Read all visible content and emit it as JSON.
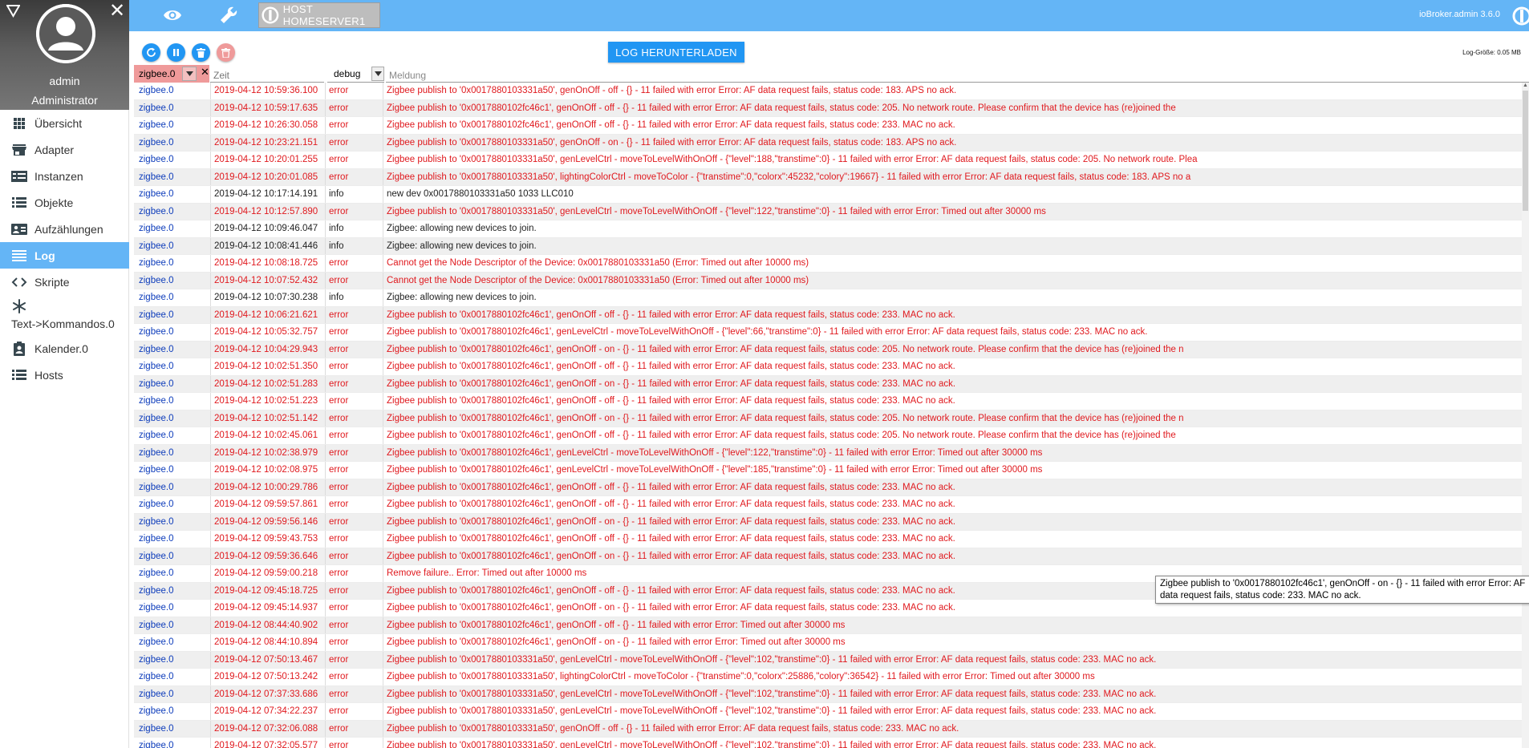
{
  "profile": {
    "name": "admin",
    "role": "Administrator"
  },
  "nav": [
    {
      "label": "Übersicht",
      "icon": "grid-icon",
      "active": false
    },
    {
      "label": "Adapter",
      "icon": "store-icon",
      "active": false
    },
    {
      "label": "Instanzen",
      "icon": "instances-icon",
      "active": false
    },
    {
      "label": "Objekte",
      "icon": "list-icon",
      "active": false
    },
    {
      "label": "Aufzählungen",
      "icon": "enum-icon",
      "active": false
    },
    {
      "label": "Log",
      "icon": "log-icon",
      "active": true
    },
    {
      "label": "Skripte",
      "icon": "code-icon",
      "active": false
    },
    {
      "label": "Text->Kommandos.0",
      "icon": "snowflake-icon",
      "active": false
    },
    {
      "label": "Kalender.0",
      "icon": "contact-icon",
      "active": false
    },
    {
      "label": "Hosts",
      "icon": "hosts-icon",
      "active": false
    }
  ],
  "topbar": {
    "host_label": "HOST HOMESERVER1",
    "version": "ioBroker.admin 3.6.0"
  },
  "toolbar": {
    "download_label": "LOG HERUNTERLADEN",
    "log_size": "Log-Größe: 0.05 MB"
  },
  "filters": {
    "instance": "zigbee.0",
    "time_placeholder": "Zeit",
    "severity": "debug",
    "message_placeholder": "Meldung"
  },
  "colors": {
    "accent": "#64b5f6",
    "button": "#2196f3",
    "error": "#e0191e",
    "instance": "#0d3cbb",
    "instance_filter": "#ef9a9a"
  },
  "tooltip": "Zigbee publish to '0x0017880102fc46c1', genOnOff - on - {} - 11 failed with error Error: AF data request fails, status code: 233. MAC no ack.",
  "log": [
    {
      "source": "zigbee.0",
      "time": "2019-04-12 10:59:36.100",
      "severity": "error",
      "message": "Zigbee publish to '0x0017880103331a50', genOnOff - off - {} - 11 failed with error Error: AF data request fails, status code: 183. APS no ack."
    },
    {
      "source": "zigbee.0",
      "time": "2019-04-12 10:59:17.635",
      "severity": "error",
      "message": "Zigbee publish to '0x0017880102fc46c1', genOnOff - off - {} - 11 failed with error Error: AF data request fails, status code: 205. No network route. Please confirm that the device has (re)joined the"
    },
    {
      "source": "zigbee.0",
      "time": "2019-04-12 10:26:30.058",
      "severity": "error",
      "message": "Zigbee publish to '0x0017880102fc46c1', genOnOff - off - {} - 11 failed with error Error: AF data request fails, status code: 233. MAC no ack."
    },
    {
      "source": "zigbee.0",
      "time": "2019-04-12 10:23:21.151",
      "severity": "error",
      "message": "Zigbee publish to '0x0017880103331a50', genOnOff - on - {} - 11 failed with error Error: AF data request fails, status code: 183. APS no ack."
    },
    {
      "source": "zigbee.0",
      "time": "2019-04-12 10:20:01.255",
      "severity": "error",
      "message": "Zigbee publish to '0x0017880103331a50', genLevelCtrl - moveToLevelWithOnOff - {\"level\":188,\"transtime\":0} - 11 failed with error Error: AF data request fails, status code: 205. No network route. Plea"
    },
    {
      "source": "zigbee.0",
      "time": "2019-04-12 10:20:01.085",
      "severity": "error",
      "message": "Zigbee publish to '0x0017880103331a50', lightingColorCtrl - moveToColor - {\"transtime\":0,\"colorx\":45232,\"colory\":19667} - 11 failed with error Error: AF data request fails, status code: 183. APS no a"
    },
    {
      "source": "zigbee.0",
      "time": "2019-04-12 10:17:14.191",
      "severity": "info",
      "message": "new dev 0x0017880103331a50 1033 LLC010"
    },
    {
      "source": "zigbee.0",
      "time": "2019-04-12 10:12:57.890",
      "severity": "error",
      "message": "Zigbee publish to '0x0017880103331a50', genLevelCtrl - moveToLevelWithOnOff - {\"level\":122,\"transtime\":0} - 11 failed with error Error: Timed out after 30000 ms"
    },
    {
      "source": "zigbee.0",
      "time": "2019-04-12 10:09:46.047",
      "severity": "info",
      "message": "Zigbee: allowing new devices to join."
    },
    {
      "source": "zigbee.0",
      "time": "2019-04-12 10:08:41.446",
      "severity": "info",
      "message": "Zigbee: allowing new devices to join."
    },
    {
      "source": "zigbee.0",
      "time": "2019-04-12 10:08:18.725",
      "severity": "error",
      "message": "Cannot get the Node Descriptor of the Device: 0x0017880103331a50 (Error: Timed out after 10000 ms)"
    },
    {
      "source": "zigbee.0",
      "time": "2019-04-12 10:07:52.432",
      "severity": "error",
      "message": "Cannot get the Node Descriptor of the Device: 0x0017880103331a50 (Error: Timed out after 10000 ms)"
    },
    {
      "source": "zigbee.0",
      "time": "2019-04-12 10:07:30.238",
      "severity": "info",
      "message": "Zigbee: allowing new devices to join."
    },
    {
      "source": "zigbee.0",
      "time": "2019-04-12 10:06:21.621",
      "severity": "error",
      "message": "Zigbee publish to '0x0017880102fc46c1', genOnOff - off - {} - 11 failed with error Error: AF data request fails, status code: 233. MAC no ack."
    },
    {
      "source": "zigbee.0",
      "time": "2019-04-12 10:05:32.757",
      "severity": "error",
      "message": "Zigbee publish to '0x0017880102fc46c1', genLevelCtrl - moveToLevelWithOnOff - {\"level\":66,\"transtime\":0} - 11 failed with error Error: AF data request fails, status code: 233. MAC no ack."
    },
    {
      "source": "zigbee.0",
      "time": "2019-04-12 10:04:29.943",
      "severity": "error",
      "message": "Zigbee publish to '0x0017880102fc46c1', genOnOff - on - {} - 11 failed with error Error: AF data request fails, status code: 205. No network route. Please confirm that the device has (re)joined the n"
    },
    {
      "source": "zigbee.0",
      "time": "2019-04-12 10:02:51.350",
      "severity": "error",
      "message": "Zigbee publish to '0x0017880102fc46c1', genOnOff - off - {} - 11 failed with error Error: AF data request fails, status code: 233. MAC no ack."
    },
    {
      "source": "zigbee.0",
      "time": "2019-04-12 10:02:51.283",
      "severity": "error",
      "message": "Zigbee publish to '0x0017880102fc46c1', genOnOff - on - {} - 11 failed with error Error: AF data request fails, status code: 233. MAC no ack."
    },
    {
      "source": "zigbee.0",
      "time": "2019-04-12 10:02:51.223",
      "severity": "error",
      "message": "Zigbee publish to '0x0017880102fc46c1', genOnOff - off - {} - 11 failed with error Error: AF data request fails, status code: 233. MAC no ack."
    },
    {
      "source": "zigbee.0",
      "time": "2019-04-12 10:02:51.142",
      "severity": "error",
      "message": "Zigbee publish to '0x0017880102fc46c1', genOnOff - on - {} - 11 failed with error Error: AF data request fails, status code: 205. No network route. Please confirm that the device has (re)joined the n"
    },
    {
      "source": "zigbee.0",
      "time": "2019-04-12 10:02:45.061",
      "severity": "error",
      "message": "Zigbee publish to '0x0017880102fc46c1', genOnOff - off - {} - 11 failed with error Error: AF data request fails, status code: 205. No network route. Please confirm that the device has (re)joined the"
    },
    {
      "source": "zigbee.0",
      "time": "2019-04-12 10:02:38.979",
      "severity": "error",
      "message": "Zigbee publish to '0x0017880102fc46c1', genLevelCtrl - moveToLevelWithOnOff - {\"level\":122,\"transtime\":0} - 11 failed with error Error: Timed out after 30000 ms"
    },
    {
      "source": "zigbee.0",
      "time": "2019-04-12 10:02:08.975",
      "severity": "error",
      "message": "Zigbee publish to '0x0017880102fc46c1', genLevelCtrl - moveToLevelWithOnOff - {\"level\":185,\"transtime\":0} - 11 failed with error Error: Timed out after 30000 ms"
    },
    {
      "source": "zigbee.0",
      "time": "2019-04-12 10:00:29.786",
      "severity": "error",
      "message": "Zigbee publish to '0x0017880102fc46c1', genOnOff - off - {} - 11 failed with error Error: AF data request fails, status code: 233. MAC no ack."
    },
    {
      "source": "zigbee.0",
      "time": "2019-04-12 09:59:57.861",
      "severity": "error",
      "message": "Zigbee publish to '0x0017880102fc46c1', genOnOff - off - {} - 11 failed with error Error: AF data request fails, status code: 233. MAC no ack."
    },
    {
      "source": "zigbee.0",
      "time": "2019-04-12 09:59:56.146",
      "severity": "error",
      "message": "Zigbee publish to '0x0017880102fc46c1', genOnOff - on - {} - 11 failed with error Error: AF data request fails, status code: 233. MAC no ack."
    },
    {
      "source": "zigbee.0",
      "time": "2019-04-12 09:59:43.753",
      "severity": "error",
      "message": "Zigbee publish to '0x0017880102fc46c1', genOnOff - off - {} - 11 failed with error Error: AF data request fails, status code: 233. MAC no ack."
    },
    {
      "source": "zigbee.0",
      "time": "2019-04-12 09:59:36.646",
      "severity": "error",
      "message": "Zigbee publish to '0x0017880102fc46c1', genOnOff - on - {} - 11 failed with error Error: AF data request fails, status code: 233. MAC no ack."
    },
    {
      "source": "zigbee.0",
      "time": "2019-04-12 09:59:00.218",
      "severity": "error",
      "message": "Remove failure.. Error: Timed out after 10000 ms"
    },
    {
      "source": "zigbee.0",
      "time": "2019-04-12 09:45:18.725",
      "severity": "error",
      "message": "Zigbee publish to '0x0017880102fc46c1', genOnOff - off - {} - 11 failed with error Error: AF data request fails, status code: 233. MAC no ack."
    },
    {
      "source": "zigbee.0",
      "time": "2019-04-12 09:45:14.937",
      "severity": "error",
      "message": "Zigbee publish to '0x0017880102fc46c1', genOnOff - on - {} - 11 failed with error Error: AF data request fails, status code: 233. MAC no ack."
    },
    {
      "source": "zigbee.0",
      "time": "2019-04-12 08:44:40.902",
      "severity": "error",
      "message": "Zigbee publish to '0x0017880102fc46c1', genOnOff - off - {} - 11 failed with error Error: Timed out after 30000 ms"
    },
    {
      "source": "zigbee.0",
      "time": "2019-04-12 08:44:10.894",
      "severity": "error",
      "message": "Zigbee publish to '0x0017880102fc46c1', genOnOff - on - {} - 11 failed with error Error: Timed out after 30000 ms"
    },
    {
      "source": "zigbee.0",
      "time": "2019-04-12 07:50:13.467",
      "severity": "error",
      "message": "Zigbee publish to '0x0017880103331a50', genLevelCtrl - moveToLevelWithOnOff - {\"level\":102,\"transtime\":0} - 11 failed with error Error: AF data request fails, status code: 233. MAC no ack."
    },
    {
      "source": "zigbee.0",
      "time": "2019-04-12 07:50:13.242",
      "severity": "error",
      "message": "Zigbee publish to '0x0017880103331a50', lightingColorCtrl - moveToColor - {\"transtime\":0,\"colorx\":25886,\"colory\":36542} - 11 failed with error Error: Timed out after 30000 ms"
    },
    {
      "source": "zigbee.0",
      "time": "2019-04-12 07:37:33.686",
      "severity": "error",
      "message": "Zigbee publish to '0x0017880103331a50', genLevelCtrl - moveToLevelWithOnOff - {\"level\":102,\"transtime\":0} - 11 failed with error Error: AF data request fails, status code: 233. MAC no ack."
    },
    {
      "source": "zigbee.0",
      "time": "2019-04-12 07:34:22.237",
      "severity": "error",
      "message": "Zigbee publish to '0x0017880103331a50', genLevelCtrl - moveToLevelWithOnOff - {\"level\":102,\"transtime\":0} - 11 failed with error Error: AF data request fails, status code: 233. MAC no ack."
    },
    {
      "source": "zigbee.0",
      "time": "2019-04-12 07:32:06.088",
      "severity": "error",
      "message": "Zigbee publish to '0x0017880103331a50', genOnOff - off - {} - 11 failed with error Error: AF data request fails, status code: 233. MAC no ack."
    },
    {
      "source": "zigbee.0",
      "time": "2019-04-12 07:32:05.577",
      "severity": "error",
      "message": "Zigbee publish to '0x0017880103331a50', genLevelCtrl - moveToLevelWithOnOff - {\"level\":102,\"transtime\":0} - 11 failed with error Error: AF data request fails, status code: 233. MAC no ack."
    }
  ]
}
